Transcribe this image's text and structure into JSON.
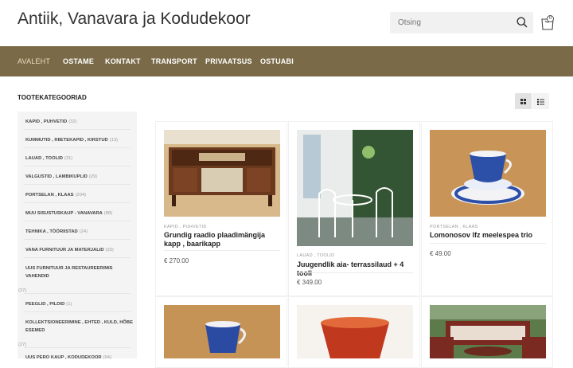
{
  "site": {
    "title": "Antiik, Vanavara ja Kodudekoor"
  },
  "search": {
    "placeholder": "Otsing"
  },
  "cart": {
    "count": "0"
  },
  "nav": [
    "AVALEHT",
    "OSTAME",
    "KONTAKT",
    "TRANSPORT",
    "PRIVAATSUS",
    "OSTUABI"
  ],
  "sidebar": {
    "heading": "TOOTEKATEGOORIAD",
    "items": [
      {
        "label": "KAPID , PUHVETID",
        "count": "(32)"
      },
      {
        "label": "KUMMUTID , RIIETEKAPID , KIRSTUD",
        "count": "(13)"
      },
      {
        "label": "LAUAD , TOOLID",
        "count": "(31)"
      },
      {
        "label": "VALGUSTID , LAMBIKUPLID",
        "count": "(29)"
      },
      {
        "label": "PORTSELAN , KLAAS",
        "count": "(204)"
      },
      {
        "label": "MUU SISUSTUSKAUP - VANAVARA",
        "count": "(88)"
      },
      {
        "label": "TEHNIKA , TÖÖRIISTAD",
        "count": "(24)"
      },
      {
        "label": "VANA FURNITUUR JA MATERJALID",
        "count": "(33)"
      },
      {
        "label": "UUS FURNITUUR JA RESTAUREERIMIS",
        "label2": "VAHENDID",
        "count": "(27)"
      },
      {
        "label": "PEEGLID , PILDID",
        "count": "(1)"
      },
      {
        "label": "KOLLEKTSIONEERIMINE , EHTED , KULD, HÕBE",
        "label2": "ESEMED",
        "count": "(27)"
      },
      {
        "label": "UUS PERO KAUP , KODUDEKOOR",
        "count": "(94)"
      }
    ]
  },
  "view": {
    "grid_icon": "grid-icon",
    "list_icon": "list-icon"
  },
  "products": [
    {
      "category": "KAPID , PUHVETID",
      "title": "Grundig raadio plaadimängija kapp , baarikapp",
      "price": "€ 270.00"
    },
    {
      "category": "LAUAD , TOOLID",
      "title": "Juugendlik aia- terrassilaud + 4 tooli",
      "price": "€ 349.00"
    },
    {
      "category": "PORTSELAN , KLAAS",
      "title": "Lomonosov lfz meelespea trio",
      "price": "€ 49.00"
    },
    {
      "category": "",
      "title": "",
      "price": ""
    },
    {
      "category": "",
      "title": "",
      "price": ""
    },
    {
      "category": "",
      "title": "",
      "price": ""
    }
  ]
}
